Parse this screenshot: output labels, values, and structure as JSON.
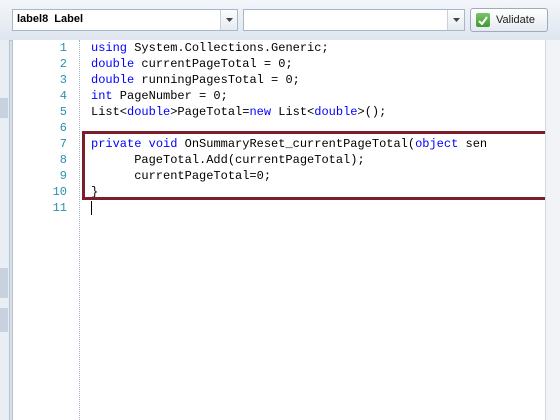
{
  "toolbar": {
    "object_selector_value": "label8  Label",
    "event_selector_value": "",
    "validate_label": "Validate"
  },
  "editor": {
    "line_numbers": [
      "1",
      "2",
      "3",
      "4",
      "5",
      "6",
      "7",
      "8",
      "9",
      "10",
      "11"
    ],
    "lines": [
      [
        {
          "t": "using",
          "k": true
        },
        {
          "t": " System.Collections.Generic;",
          "k": false
        }
      ],
      [
        {
          "t": "double",
          "k": true
        },
        {
          "t": " currentPageTotal = 0;",
          "k": false
        }
      ],
      [
        {
          "t": "double",
          "k": true
        },
        {
          "t": " runningPagesTotal = 0;",
          "k": false
        }
      ],
      [
        {
          "t": "int",
          "k": true
        },
        {
          "t": " PageNumber = 0;",
          "k": false
        }
      ],
      [
        {
          "t": "List<",
          "k": false
        },
        {
          "t": "double",
          "k": true
        },
        {
          "t": ">PageTotal=",
          "k": false
        },
        {
          "t": "new",
          "k": true
        },
        {
          "t": " List<",
          "k": false
        },
        {
          "t": "double",
          "k": true
        },
        {
          "t": ">();",
          "k": false
        }
      ],
      [],
      [
        {
          "t": "private",
          "k": true
        },
        {
          "t": " ",
          "k": false
        },
        {
          "t": "void",
          "k": true
        },
        {
          "t": " OnSummaryReset_currentPageTotal(",
          "k": false
        },
        {
          "t": "object",
          "k": true
        },
        {
          "t": " sen",
          "k": false
        }
      ],
      [
        {
          "t": "      PageTotal.Add(currentPageTotal);",
          "k": false
        }
      ],
      [
        {
          "t": "      currentPageTotal=0;",
          "k": false
        }
      ],
      [
        {
          "t": "}",
          "k": false
        }
      ],
      []
    ]
  },
  "colors": {
    "keyword": "#0000ff",
    "line_number": "#2b91af",
    "highlight_border": "#7b1d2a"
  }
}
